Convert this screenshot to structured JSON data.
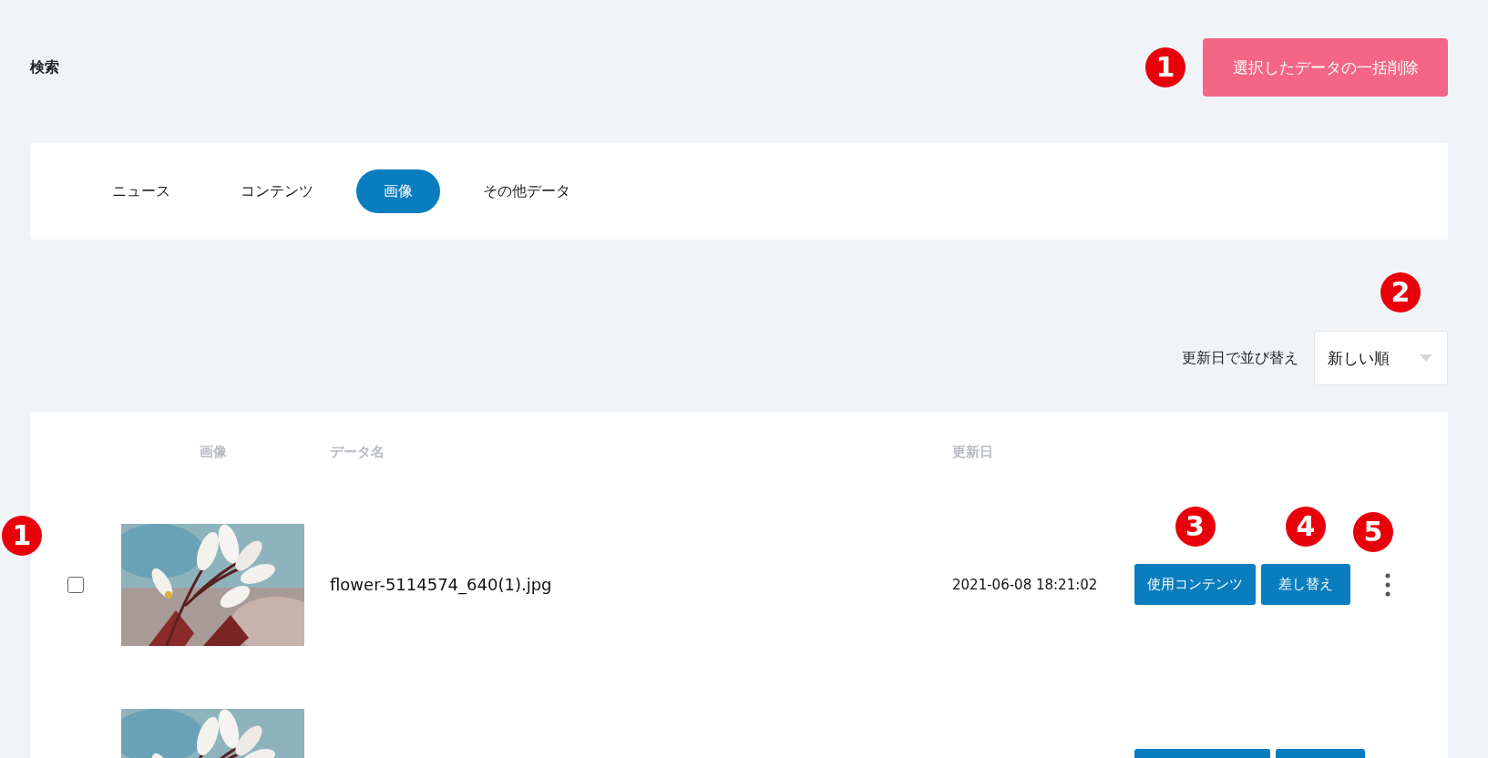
{
  "page_title": "検索",
  "bulk_delete": {
    "label": "選択したデータの一括削除",
    "callout": "1"
  },
  "tabs": [
    {
      "label": "ニュース",
      "selected": false
    },
    {
      "label": "コンテンツ",
      "selected": false
    },
    {
      "label": "画像",
      "selected": true
    },
    {
      "label": "その他データ",
      "selected": false
    }
  ],
  "sort": {
    "label": "更新日で並び替え",
    "value": "新しい順",
    "callout": "2"
  },
  "table": {
    "columns": [
      "画像",
      "データ名",
      "更新日"
    ],
    "rows": [
      {
        "kind": "full",
        "checked": false,
        "callout": "1",
        "name": "flower-5114574_640(1).jpg",
        "date": "2021-06-08 18:21:02",
        "actions": [
          {
            "label": "使用コンテンツ",
            "callout": "3"
          },
          {
            "label": "差し替え",
            "callout": "4"
          }
        ],
        "menu_callout": "5"
      },
      {
        "kind": "partial"
      }
    ]
  }
}
